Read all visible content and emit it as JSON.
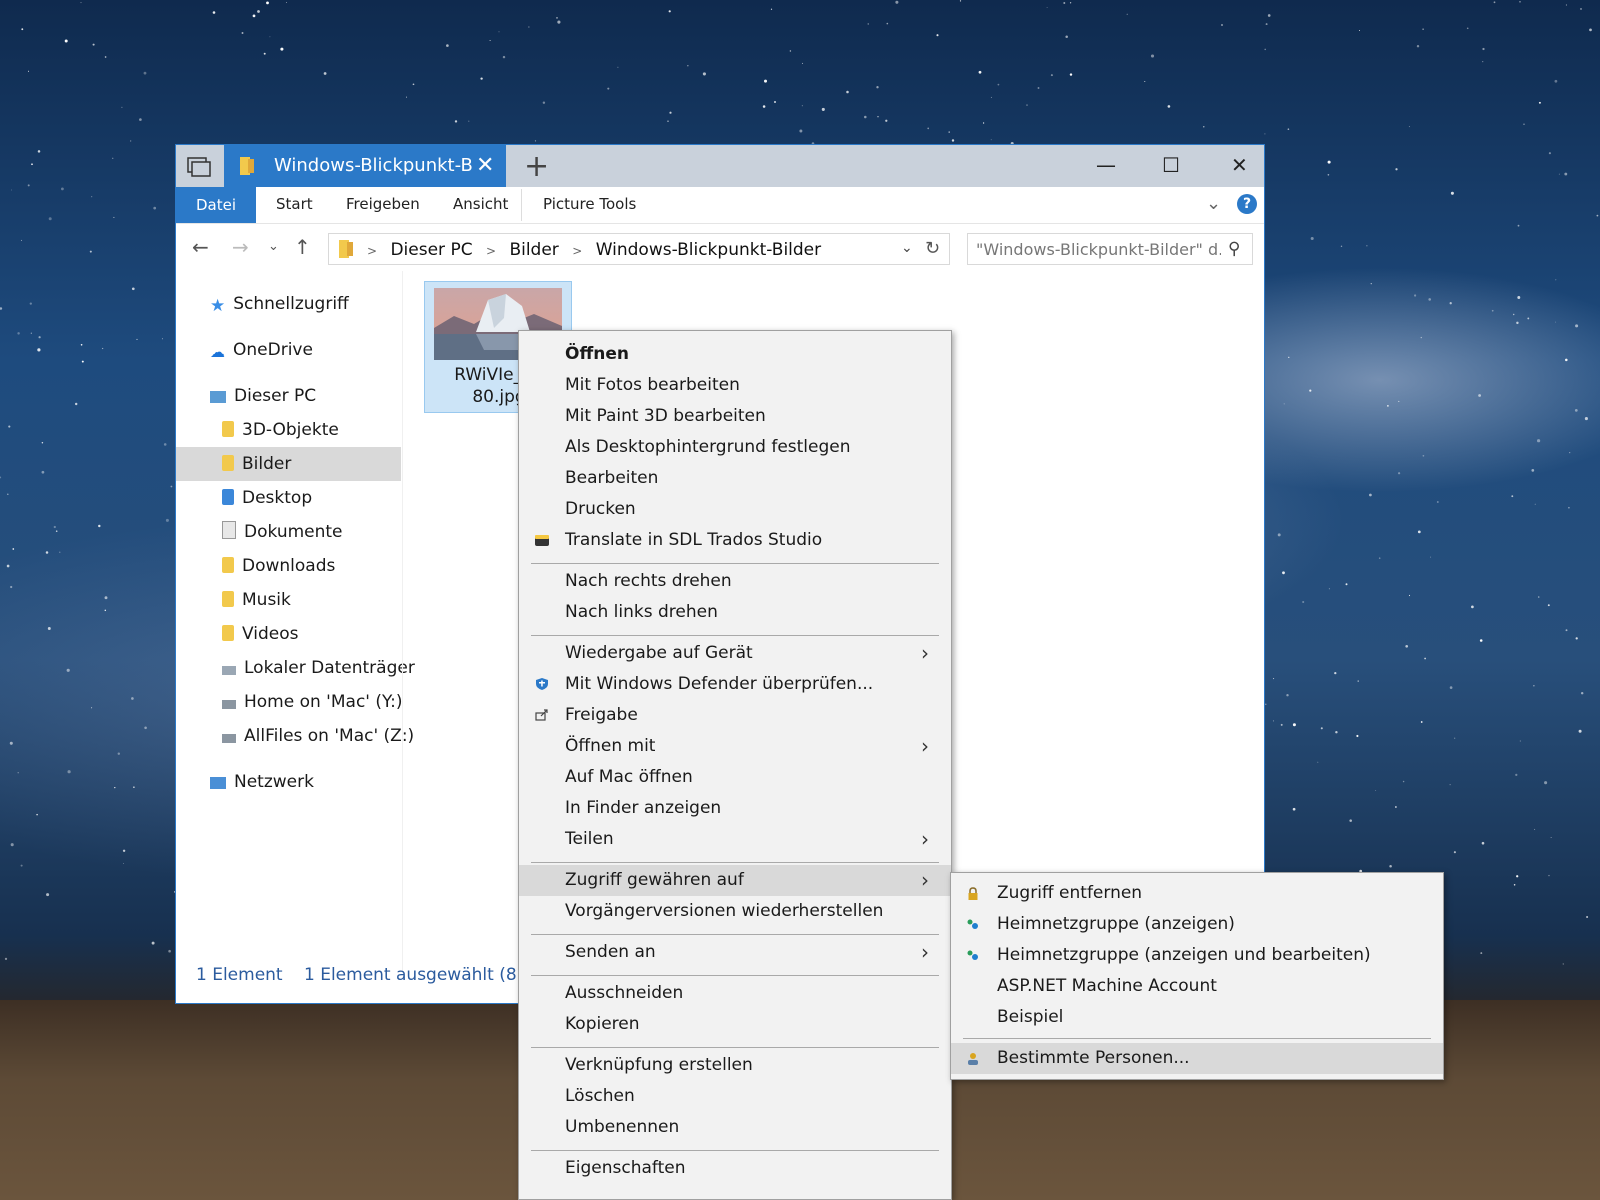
{
  "window": {
    "tab_title": "Windows-Blickpunkt-B",
    "minimize": "—",
    "maximize": "☐",
    "close": "✕",
    "new_tab": "+"
  },
  "ribbon": {
    "tabs": [
      "Datei",
      "Start",
      "Freigeben",
      "Ansicht",
      "Picture Tools"
    ],
    "help": "?"
  },
  "address": {
    "crumbs": [
      "Dieser PC",
      "Bilder",
      "Windows-Blickpunkt-Bilder"
    ],
    "search_placeholder": "\"Windows-Blickpunkt-Bilder\" d..."
  },
  "sidebar": {
    "items": [
      {
        "label": "Schnellzugriff",
        "icon": "star-icon"
      },
      {
        "label": "OneDrive",
        "icon": "cloud-icon"
      },
      {
        "label": "Dieser PC",
        "icon": "computer-icon"
      },
      {
        "label": "3D-Objekte",
        "icon": "folder-icon"
      },
      {
        "label": "Bilder",
        "icon": "pictures-folder-icon"
      },
      {
        "label": "Desktop",
        "icon": "desktop-folder-icon"
      },
      {
        "label": "Dokumente",
        "icon": "documents-folder-icon"
      },
      {
        "label": "Downloads",
        "icon": "downloads-folder-icon"
      },
      {
        "label": "Musik",
        "icon": "music-folder-icon"
      },
      {
        "label": "Videos",
        "icon": "videos-folder-icon"
      },
      {
        "label": "Lokaler Datenträger",
        "icon": "drive-icon"
      },
      {
        "label": "Home on 'Mac' (Y:)",
        "icon": "network-drive-icon"
      },
      {
        "label": "AllFiles on 'Mac' (Z:)",
        "icon": "network-drive-icon"
      },
      {
        "label": "Netzwerk",
        "icon": "network-icon"
      }
    ]
  },
  "file": {
    "name_line1": "RWiVIe_19",
    "name_line2": "80.jpg"
  },
  "status": {
    "count": "1 Element",
    "selected": "1 Element ausgewählt (818 K"
  },
  "context_menu": {
    "items": [
      "Öffnen",
      "Mit Fotos bearbeiten",
      "Mit Paint 3D bearbeiten",
      "Als Desktophintergrund festlegen",
      "Bearbeiten",
      "Drucken",
      "Translate in SDL Trados Studio",
      "Nach rechts drehen",
      "Nach links drehen",
      "Wiedergabe auf Gerät",
      "Mit Windows Defender überprüfen...",
      "Freigabe",
      "Öffnen mit",
      "Auf Mac öffnen",
      "In Finder anzeigen",
      "Teilen",
      "Zugriff gewähren auf",
      "Vorgängerversionen wiederherstellen",
      "Senden an",
      "Ausschneiden",
      "Kopieren",
      "Verknüpfung erstellen",
      "Löschen",
      "Umbenennen",
      "Eigenschaften"
    ],
    "submenu_arrow": "›"
  },
  "submenu": {
    "items": [
      "Zugriff entfernen",
      "Heimnetzgruppe (anzeigen)",
      "Heimnetzgruppe (anzeigen und bearbeiten)",
      "ASP.NET Machine Account",
      "Beispiel",
      "Bestimmte Personen..."
    ]
  },
  "colors": {
    "accent": "#2b79c8",
    "menu_bg": "#f2f2f2",
    "highlight": "#d9d9d9",
    "selection": "#cce4f7"
  }
}
